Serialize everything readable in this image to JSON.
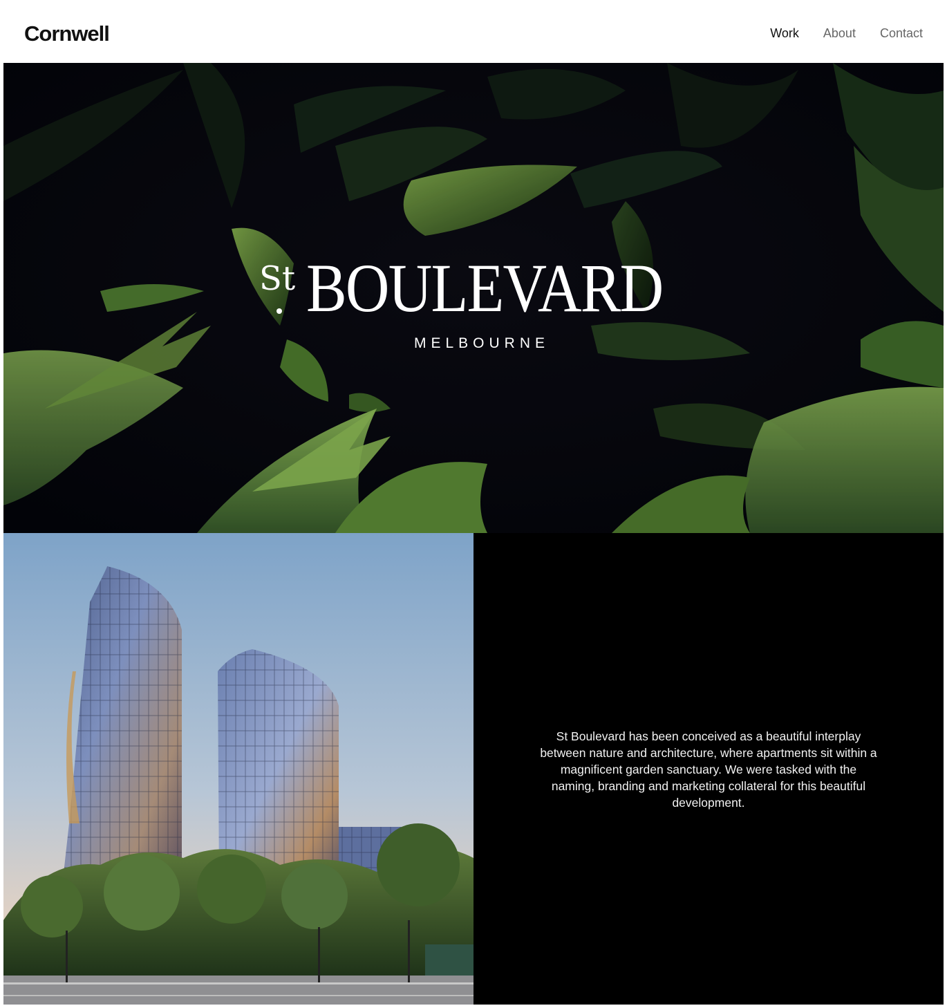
{
  "header": {
    "logo": "Cornwell",
    "nav": [
      {
        "label": "Work",
        "active": true
      },
      {
        "label": "About",
        "active": false
      },
      {
        "label": "Contact",
        "active": false
      }
    ]
  },
  "hero": {
    "brand_prefix": "St",
    "brand_name": "BOULEVARD",
    "brand_city": "MELBOURNE",
    "image_subject": "dark-fern-foliage"
  },
  "project": {
    "image_subject": "twin-glass-towers-with-trees",
    "description": "St Boulevard has been conceived as a beautiful interplay between nature and architecture, where apartments sit within a magnificent garden sanctuary. We were tasked with the naming, branding and marketing collateral for this beautiful development."
  },
  "colors": {
    "header_bg": "#ffffff",
    "text_dark": "#111111",
    "nav_inactive": "#666666",
    "panel_bg": "#000000",
    "panel_text": "#f2f2f2"
  }
}
